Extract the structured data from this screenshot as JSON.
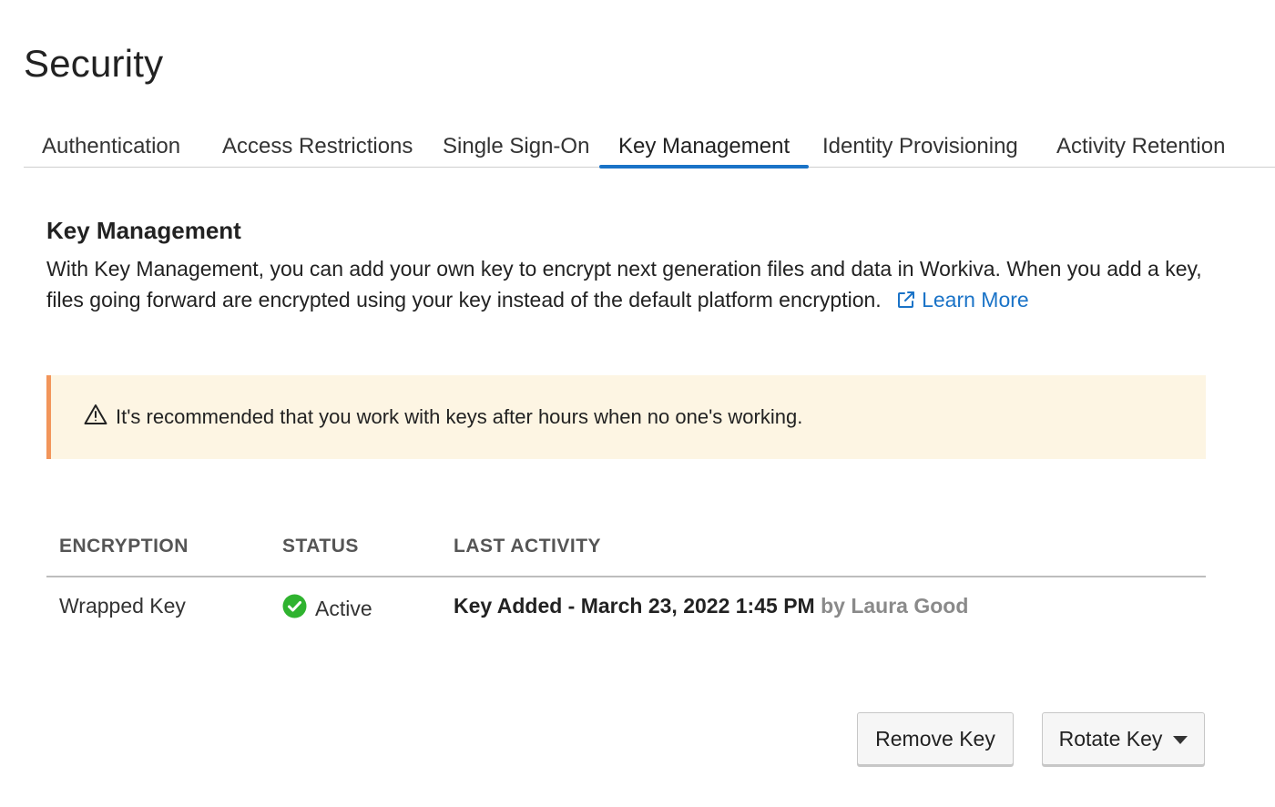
{
  "page": {
    "title": "Security"
  },
  "tabs": [
    {
      "label": "Authentication",
      "active": false
    },
    {
      "label": "Access Restrictions",
      "active": false
    },
    {
      "label": "Single Sign-On",
      "active": false
    },
    {
      "label": "Key Management",
      "active": true
    },
    {
      "label": "Identity Provisioning",
      "active": false
    },
    {
      "label": "Activity Retention",
      "active": false
    }
  ],
  "section": {
    "title": "Key Management",
    "description": "With Key Management, you can add your own key to encrypt next generation files and data in Workiva. When you add a key, files going forward are encrypted using your key instead of the default platform encryption.",
    "learn_more": "Learn More",
    "learn_more_icon": "external-link-icon"
  },
  "alert": {
    "icon": "warning-icon",
    "text": "It's recommended that you work with keys after hours when no one's working."
  },
  "table": {
    "headers": {
      "encryption": "ENCRYPTION",
      "status": "STATUS",
      "last_activity": "LAST ACTIVITY"
    },
    "rows": [
      {
        "encryption": "Wrapped Key",
        "status": "Active",
        "status_icon": "check-circle-icon",
        "activity": "Key Added - March 23, 2022 1:45 PM",
        "activity_by": "by Laura Good"
      }
    ]
  },
  "actions": {
    "remove_label": "Remove Key",
    "rotate_label": "Rotate Key"
  },
  "colors": {
    "accent": "#1a73c7",
    "alert_bg": "#fdf5e3",
    "alert_border": "#f2955a",
    "success": "#2fb32f"
  }
}
